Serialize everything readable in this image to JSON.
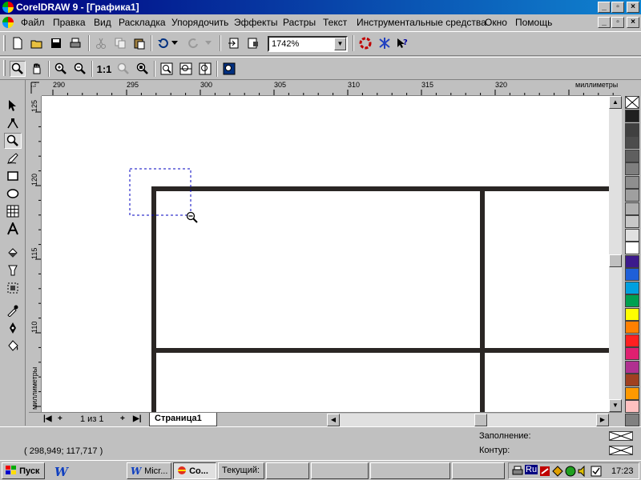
{
  "window": {
    "title": "CorelDRAW 9 - [Графика1]",
    "min": "_",
    "max": "▫",
    "close": "×"
  },
  "menu": {
    "items": [
      "Файл",
      "Правка",
      "Вид",
      "Раскладка",
      "Упорядочить",
      "Эффекты",
      "Растры",
      "Текст",
      "Инструментальные средства",
      "Окно",
      "Помощь"
    ]
  },
  "toolbar": {
    "zoom_value": "1742%"
  },
  "zoom_toolbar": {
    "one_to_one": "1:1"
  },
  "ruler": {
    "h_labels": [
      "290",
      "295",
      "300",
      "305",
      "310",
      "315",
      "320",
      "миллиметры"
    ],
    "v_labels": [
      "125",
      "120",
      "115",
      "110",
      "миллиметры"
    ]
  },
  "pages": {
    "counter": "1 из 1",
    "tab_label": "Страница1"
  },
  "status": {
    "coords": "( 298,949; 117,717 )",
    "fill_label": "Заполнение:",
    "outline_label": "Контур:"
  },
  "taskbar": {
    "start_label": "Пуск",
    "items": [
      "Micr...",
      "Co...",
      "Текущий:"
    ],
    "lang": "Ru",
    "clock": "17:23"
  },
  "palette_colors": [
    "#202020",
    "#404040",
    "#4d4d4d",
    "#5f5f5f",
    "#7f7f7f",
    "#8f8f8f",
    "#9f9f9f",
    "#b0b0b0",
    "#c8c8c8",
    "#e0e0e0",
    "#ffffff",
    "#3c1a8c",
    "#1e5fd8",
    "#00a0e0",
    "#00a050",
    "#ffff00",
    "#ff8000",
    "#ff2020",
    "#e02070",
    "#b03090",
    "#a04020",
    "#ff9900",
    "#ffc0c0",
    "#808080"
  ]
}
